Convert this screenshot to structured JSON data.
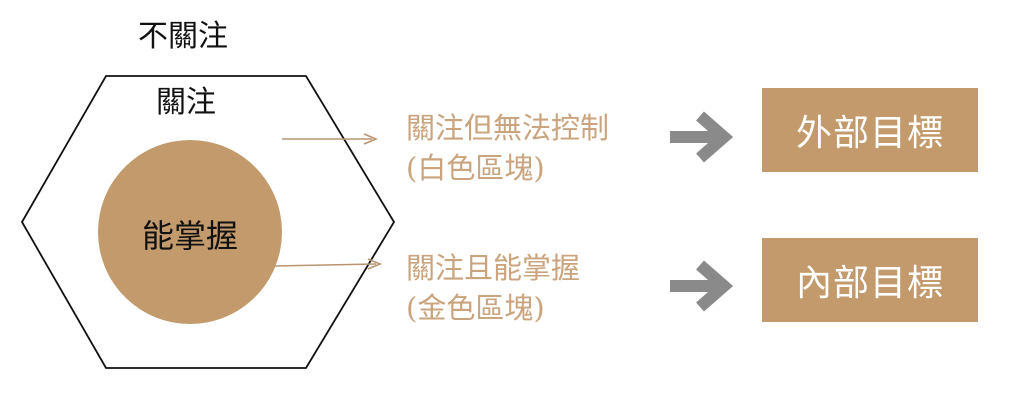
{
  "diagram": {
    "outer_label": "不關注",
    "hexagon_label": "關注",
    "circle_label": "能掌握",
    "annotations": [
      {
        "line1": "關注但無法控制",
        "line2": "(白色區塊)"
      },
      {
        "line1": "關注且能掌握",
        "line2": "(金色區塊)"
      }
    ],
    "targets": [
      {
        "label": "外部目標"
      },
      {
        "label": "內部目標"
      }
    ]
  },
  "colors": {
    "gold_fill": "#c39a6b",
    "gold_text": "#c9a47c",
    "connector": "#b89570",
    "big_arrow": "#8a8a8a",
    "outline": "#111111"
  }
}
